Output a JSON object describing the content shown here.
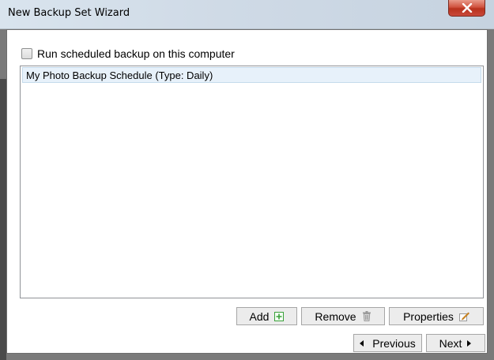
{
  "window": {
    "title": "New Backup Set Wizard",
    "close_glyph": "x"
  },
  "schedule": {
    "checkbox_label": "Run scheduled backup on this computer",
    "checked": false,
    "items": [
      {
        "label": "My Photo Backup Schedule (Type: Daily)"
      }
    ]
  },
  "actions": {
    "add_label": "Add",
    "remove_label": "Remove",
    "properties_label": "Properties"
  },
  "navigation": {
    "previous_label": "Previous",
    "next_label": "Next"
  },
  "icons": {
    "add": "plus-box-icon",
    "remove": "trash-icon",
    "properties": "edit-icon",
    "previous": "arrow-left-icon",
    "next": "arrow-right-icon",
    "close": "close-icon"
  },
  "colors": {
    "close_button": "#c9483a",
    "selected_row": "#e7f1fa",
    "add_icon": "#3aa03a",
    "edit_icon": "#e39b2b"
  }
}
